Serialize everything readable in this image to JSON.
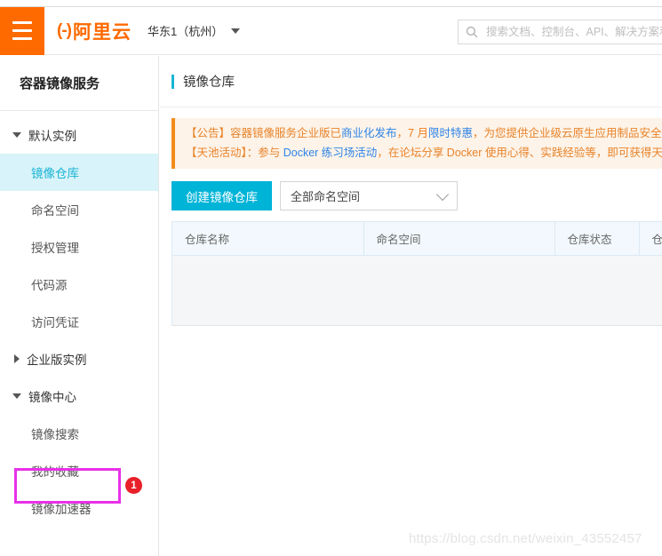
{
  "header": {
    "menu_icon": "hamburger-icon",
    "brand_mark": "(-)",
    "brand_text": "阿里云",
    "region_label": "华东1（杭州）",
    "search_placeholder": "搜索文档、控制台、API、解决方案和",
    "search_value": ""
  },
  "sidebar": {
    "title": "容器镜像服务",
    "groups": [
      {
        "label": "默认实例",
        "expanded": true,
        "items": [
          {
            "label": "镜像仓库",
            "active": true
          },
          {
            "label": "命名空间",
            "active": false
          },
          {
            "label": "授权管理",
            "active": false
          },
          {
            "label": "代码源",
            "active": false
          },
          {
            "label": "访问凭证",
            "active": false
          }
        ]
      },
      {
        "label": "企业版实例",
        "expanded": false,
        "items": []
      },
      {
        "label": "镜像中心",
        "expanded": true,
        "items": [
          {
            "label": "镜像搜索",
            "active": false
          },
          {
            "label": "我的收藏",
            "active": false
          },
          {
            "label": "镜像加速器",
            "active": false,
            "highlighted": true
          }
        ]
      }
    ],
    "annotation_badge": "1"
  },
  "main": {
    "page_title": "镜像仓库",
    "notice": {
      "line1": {
        "prefix": "【公告】容器镜像服务企业版已",
        "link1": "商业化发布",
        "mid1": "，",
        "orange1": "7 月",
        "link2": "限时特惠",
        "suffix": "，为您提供企业级云原生应用制品安全托管"
      },
      "line2": {
        "prefix": "【天池活动】：参与 ",
        "link1": "Docker 练习场活动",
        "suffix": "，在论坛分享 Docker 使用心得、实践经验等，即可获得天池"
      }
    },
    "toolbar": {
      "create_button": "创建镜像仓库",
      "namespace_select_value": "全部命名空间"
    },
    "table": {
      "columns": [
        "仓库名称",
        "命名空间",
        "仓库状态",
        "仓库类"
      ],
      "rows": []
    }
  },
  "watermark": "https://blog.csdn.net/weixin_43552457",
  "colors": {
    "brand_orange": "#ff6a00",
    "accent_cyan": "#00b4d8",
    "active_nav_bg": "#d8f3f9",
    "notice_bg": "#fdf3e8",
    "notice_border": "#f38b1c",
    "highlight_magenta": "#e831e8",
    "badge_red": "#e8202a"
  }
}
